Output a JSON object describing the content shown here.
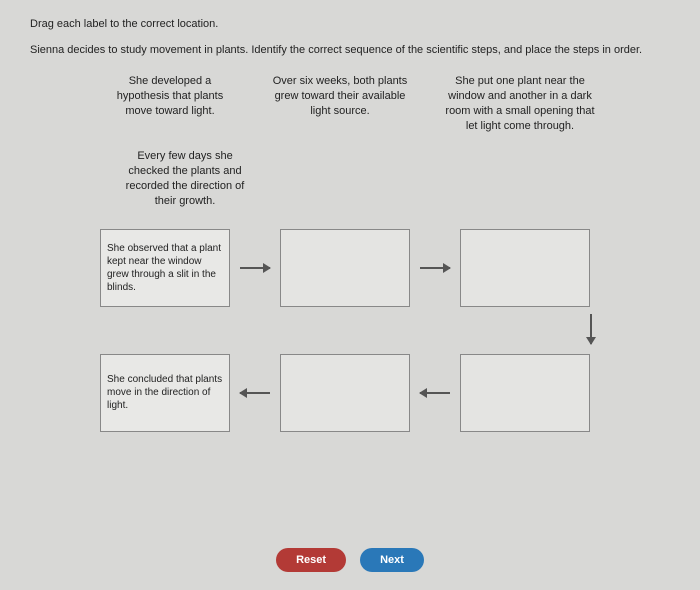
{
  "instruction": "Drag each label to the correct location.",
  "prompt": "Sienna decides to study movement in plants. Identify the correct sequence of the scientific steps, and place the steps in order.",
  "labels": {
    "l1": "She developed a hypothesis that plants move toward light.",
    "l2": "Over six weeks, both plants grew toward their available light source.",
    "l3": "She put one plant near the window and another in a dark room with a small opening that let light come through.",
    "l4": "Every few days she checked the plants and recorded the direction of their growth."
  },
  "prefilled": {
    "box1": "She observed that a plant kept near the window grew through a slit in the blinds.",
    "box6": "She concluded that plants move in the direction of light."
  },
  "buttons": {
    "reset": "Reset",
    "next": "Next"
  }
}
